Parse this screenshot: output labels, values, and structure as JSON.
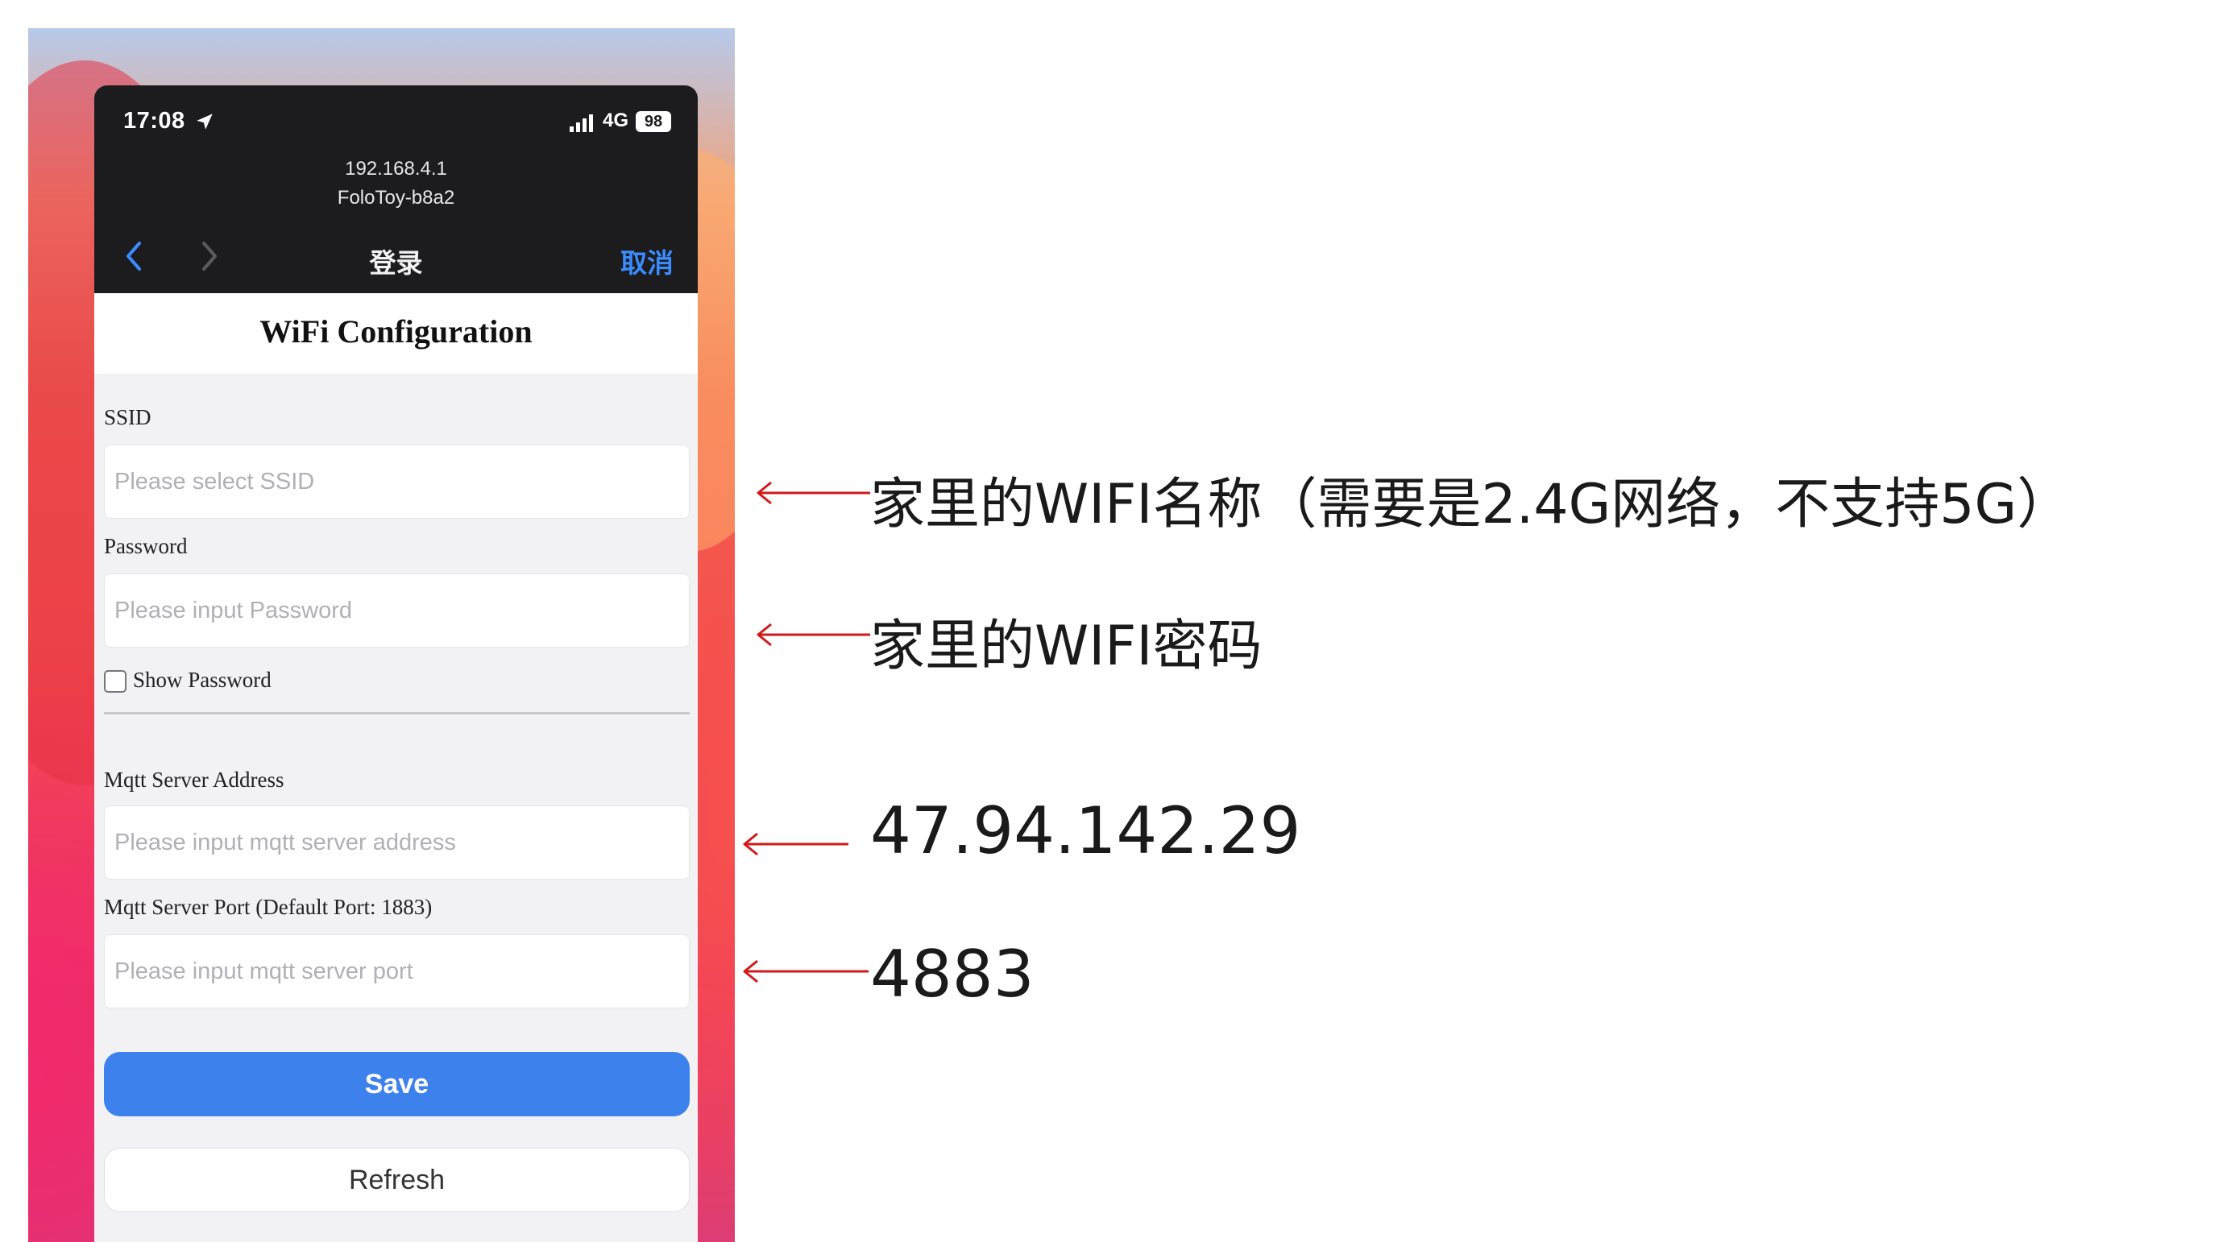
{
  "status_bar": {
    "time": "17:08",
    "network": "4G",
    "battery": "98",
    "icons": [
      "location-arrow-icon",
      "cellular-signal-icon",
      "battery-icon"
    ]
  },
  "browser": {
    "host": "192.168.4.1",
    "network_name": "FoloToy-b8a2",
    "nav_title": "登录",
    "cancel_label": "取消",
    "icons": [
      "back-chevron-icon",
      "forward-chevron-icon"
    ],
    "accent_color": "#3b8cff"
  },
  "form": {
    "title": "WiFi Configuration",
    "ssid": {
      "label": "SSID",
      "placeholder": "Please select SSID",
      "value": ""
    },
    "password": {
      "label": "Password",
      "placeholder": "Please input Password",
      "value": ""
    },
    "show_password": {
      "label": "Show Password",
      "checked": false
    },
    "mqtt_address": {
      "label": "Mqtt Server Address",
      "placeholder": "Please input mqtt server address",
      "value": ""
    },
    "mqtt_port": {
      "label": "Mqtt Server Port (Default Port: 1883)",
      "placeholder": "Please input mqtt server port",
      "value": ""
    },
    "save_label": "Save",
    "refresh_label": "Refresh",
    "save_color": "#3d82ec"
  },
  "annotations": {
    "ssid_note": "家里的WIFI名称（需要是2.4G网络，不支持5G）",
    "password_note": "家里的WIFI密码",
    "mqtt_address_note": "47.94.142.29",
    "mqtt_port_note": "4883",
    "arrow_color": "#d11a1a"
  }
}
